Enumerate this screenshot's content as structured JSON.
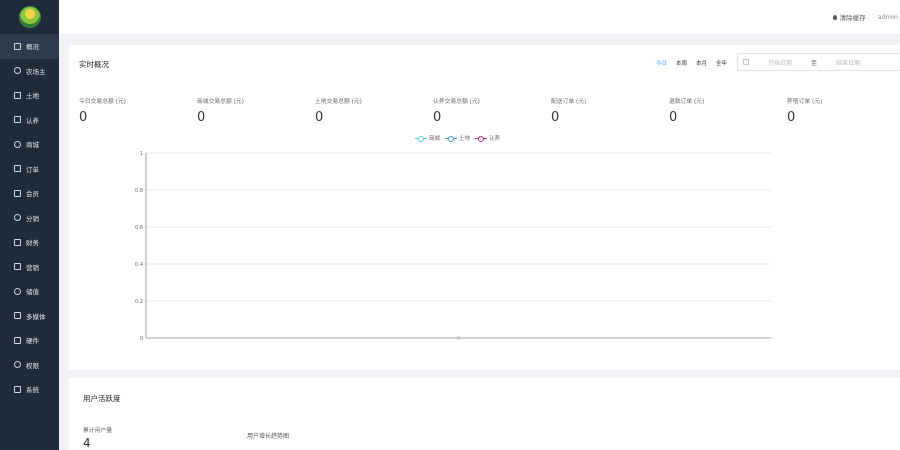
{
  "sidebar": {
    "items": [
      {
        "label": "概况",
        "icon": "home-icon",
        "active": true
      },
      {
        "label": "农场主",
        "icon": "user-icon",
        "active": false
      },
      {
        "label": "土地",
        "icon": "land-icon",
        "active": false
      },
      {
        "label": "认养",
        "icon": "adopt-icon",
        "active": false
      },
      {
        "label": "商城",
        "icon": "store-icon",
        "active": false
      },
      {
        "label": "订单",
        "icon": "order-icon",
        "active": false
      },
      {
        "label": "会员",
        "icon": "member-icon",
        "active": false
      },
      {
        "label": "分销",
        "icon": "distribution-icon",
        "active": false
      },
      {
        "label": "财务",
        "icon": "finance-icon",
        "active": false
      },
      {
        "label": "营销",
        "icon": "marketing-icon",
        "active": false
      },
      {
        "label": "储值",
        "icon": "wallet-icon",
        "active": false
      },
      {
        "label": "多媒体",
        "icon": "media-icon",
        "active": false
      },
      {
        "label": "硬件",
        "icon": "hardware-icon",
        "active": false
      },
      {
        "label": "权限",
        "icon": "permission-icon",
        "active": false
      },
      {
        "label": "系统",
        "icon": "gear-icon",
        "active": false
      }
    ]
  },
  "topbar": {
    "clear_cache": "清除缓存",
    "user": "admin"
  },
  "realtime": {
    "title": "实时概况",
    "range_tabs": [
      "今日",
      "本周",
      "本月",
      "全年"
    ],
    "active_range": 0,
    "date_start_placeholder": "开始日期",
    "date_separator": "至",
    "date_end_placeholder": "结束日期",
    "stats": [
      {
        "label": "今日交易总额 (元)",
        "value": "0"
      },
      {
        "label": "商城交易总额 (元)",
        "value": "0"
      },
      {
        "label": "土地交易总额 (元)",
        "value": "0"
      },
      {
        "label": "认养交易总额 (元)",
        "value": "0"
      },
      {
        "label": "配送订单 (元)",
        "value": "0"
      },
      {
        "label": "退款订单 (元)",
        "value": "0"
      },
      {
        "label": "养殖订单 (元)",
        "value": "0"
      }
    ]
  },
  "chart_data": {
    "type": "line",
    "series": [
      {
        "name": "商城",
        "color": "#5ac8e0",
        "values": [
          0
        ]
      },
      {
        "name": "土地",
        "color": "#3aa0c8",
        "values": [
          0
        ]
      },
      {
        "name": "认养",
        "color": "#c7358a",
        "values": [
          0
        ]
      }
    ],
    "x": [
      ""
    ],
    "y_ticks": [
      "0",
      "0.2",
      "0.4",
      "0.6",
      "0.8",
      "1"
    ],
    "ylim": [
      0,
      1
    ],
    "grid": true,
    "legend": "top-center"
  },
  "activity": {
    "title": "用户活跃度",
    "accumulated_label": "累计用户量",
    "accumulated_value": "4",
    "growth_chart_label": "用户增长趋势图"
  }
}
